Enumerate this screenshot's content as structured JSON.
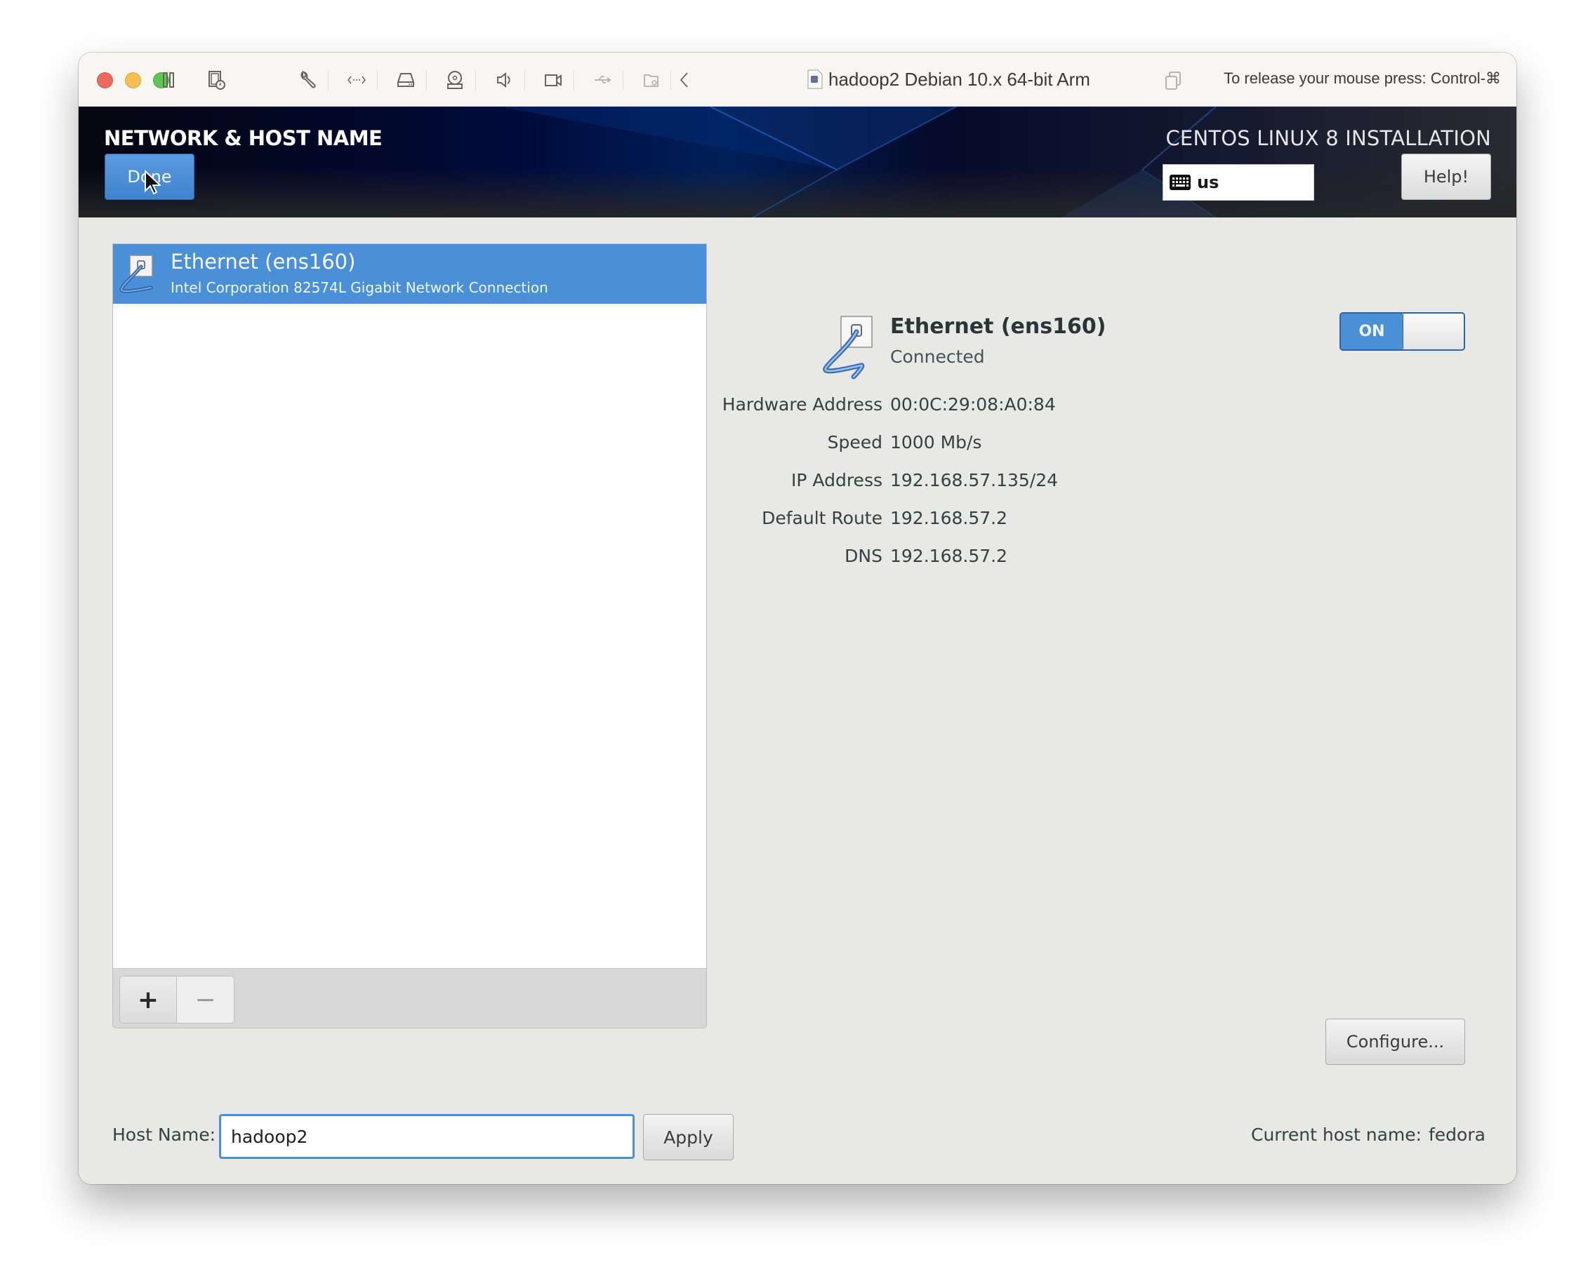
{
  "vm_window": {
    "title": "hadoop2 Debian 10.x 64-bit Arm",
    "release_hint": "To release your mouse press: Control-⌘",
    "toolbar_icons": [
      "pause-icon",
      "snapshot-icon",
      "wrench-icon",
      "network-adapter-icon",
      "hard-disk-icon",
      "cd-dvd-icon",
      "sound-icon",
      "camera-icon",
      "usb-icon",
      "shared-folder-icon",
      "chevron-left-icon"
    ]
  },
  "header": {
    "spoke_title": "NETWORK & HOST NAME",
    "done_label": "Done",
    "product_title": "CENTOS LINUX 8 INSTALLATION",
    "keyboard_layout": "us",
    "help_label": "Help!"
  },
  "devices": [
    {
      "name": "Ethernet (ens160)",
      "description": "Intel Corporation 82574L Gigabit Network Connection",
      "selected": true
    }
  ],
  "list_toolbar": {
    "add_label": "+",
    "remove_label": "−"
  },
  "details": {
    "name": "Ethernet (ens160)",
    "status": "Connected",
    "toggle_label": "ON",
    "toggle_on": true,
    "rows": [
      {
        "label": "Hardware Address",
        "value": "00:0C:29:08:A0:84"
      },
      {
        "label": "Speed",
        "value": "1000 Mb/s"
      },
      {
        "label": "IP Address",
        "value": "192.168.57.135/24"
      },
      {
        "label": "Default Route",
        "value": "192.168.57.2"
      },
      {
        "label": "DNS",
        "value": "192.168.57.2"
      }
    ],
    "configure_label": "Configure..."
  },
  "hostname": {
    "label": "Host Name:",
    "value": "hadoop2",
    "apply_label": "Apply",
    "current_label": "Current host name:",
    "current_value": "fedora"
  },
  "colors": {
    "accent": "#4a90d9",
    "header_dark": "#00205a",
    "content_bg": "#e8e8e7"
  }
}
